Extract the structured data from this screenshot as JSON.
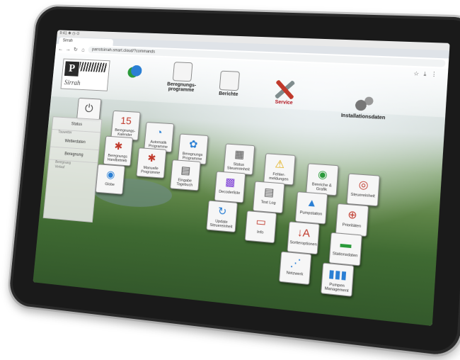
{
  "browser": {
    "status_text": "9:41 ✱ ◷ ⊙",
    "tab_title": "Sirrah",
    "url": "parrotsirrah.smart.cloud/?commands",
    "icons": [
      "star-icon",
      "download-icon",
      "menu-icon"
    ]
  },
  "logo": {
    "mark": "P",
    "brand": "Sirrah"
  },
  "nav": [
    {
      "label": "",
      "icon": "drops-icon"
    },
    {
      "label": "Beregnungs-programme",
      "icon": "document-icon"
    },
    {
      "label": "Berichte",
      "icon": "report-icon"
    },
    {
      "label": "Service",
      "icon": "tools-icon"
    },
    {
      "label": "Installationsdaten",
      "icon": "gears-icon"
    }
  ],
  "sidebar": {
    "items": [
      "Status",
      "Wetterdaten",
      "Beregnung"
    ],
    "subitems": [
      "Tauwetter",
      "Beregnung",
      "Verlauf"
    ]
  },
  "tiles": [
    {
      "label": "Beregnungs-Kalender",
      "glyph": "15",
      "color": "#c0392b"
    },
    {
      "label": "Automatik Programme",
      "glyph": "◔",
      "color": "#2a7fd4"
    },
    {
      "label": "Beregnungs Programme",
      "glyph": "✿",
      "color": "#2a7fd4"
    },
    {
      "label": "Beregnungs Handbetrieb",
      "glyph": "✱",
      "color": "#c0392b"
    },
    {
      "label": "Manuelle Programme",
      "glyph": "✱",
      "color": "#c0392b"
    },
    {
      "label": "Eingabe Tagebuch",
      "glyph": "▤",
      "color": "#444444"
    },
    {
      "label": "Status Steuereinheit",
      "glyph": "▦",
      "color": "#555555"
    },
    {
      "label": "Fehler-meldungen",
      "glyph": "⚠",
      "color": "#e0a800"
    },
    {
      "label": "Bereiche & Grafik",
      "glyph": "◉",
      "color": "#2a9a3a"
    },
    {
      "label": "Steuereinheit",
      "glyph": "◎",
      "color": "#c0392b"
    },
    {
      "label": "Globe",
      "glyph": "◉",
      "color": "#2a7fd4"
    },
    {
      "label": "Decoderliste",
      "glyph": "▩",
      "color": "#7a3bd4"
    },
    {
      "label": "Test Log",
      "glyph": "▤",
      "color": "#555555"
    },
    {
      "label": "Pumpstation",
      "glyph": "▲",
      "color": "#2a7fd4"
    },
    {
      "label": "Prioritäten",
      "glyph": "⊕",
      "color": "#c0392b"
    },
    {
      "label": "Update Steuereinheit",
      "glyph": "↻",
      "color": "#2a7fd4"
    },
    {
      "label": "Info",
      "glyph": "▭",
      "color": "#c0392b"
    },
    {
      "label": "Sortieroptionen",
      "glyph": "↓A",
      "color": "#c0392b"
    },
    {
      "label": "Stationsdaten",
      "glyph": "▬",
      "color": "#2a9a3a"
    },
    {
      "label": "Netzwerk",
      "glyph": "⋰",
      "color": "#2a7fd4"
    },
    {
      "label": "Pumpen Management",
      "glyph": "▮▮▮",
      "color": "#2a7fd4"
    }
  ]
}
